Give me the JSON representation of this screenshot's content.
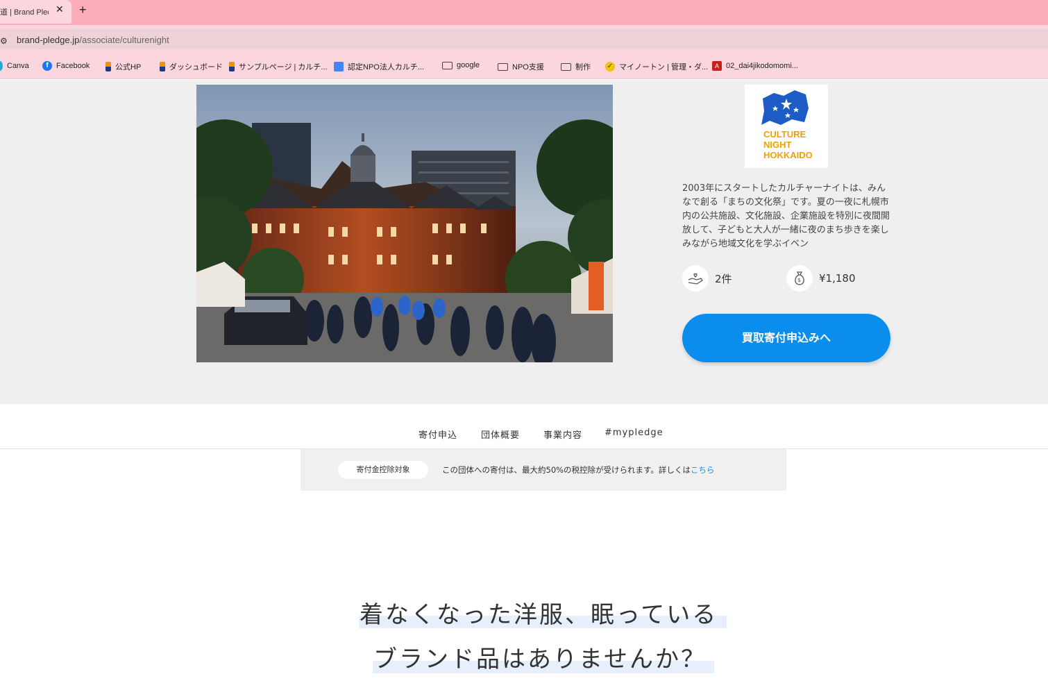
{
  "browser": {
    "tab_title": "道 | Brand Pledge",
    "tab_close": "✕",
    "new_tab": "+",
    "url_host": "brand-pledge.jp",
    "url_path": "/associate/culturenight",
    "bookmarks": [
      {
        "label": "Canva",
        "icon": "canva-icon"
      },
      {
        "label": "Facebook",
        "icon": "facebook-icon"
      },
      {
        "label": "公式HP",
        "icon": "bar-icon"
      },
      {
        "label": "ダッシュボード",
        "icon": "bar-icon"
      },
      {
        "label": "サンプルページ | カルチ...",
        "icon": "bar-icon"
      },
      {
        "label": "認定NPO法人カルチ...",
        "icon": "doc-icon"
      },
      {
        "label": "google",
        "icon": "folder-icon"
      },
      {
        "label": "NPO支援",
        "icon": "folder-icon"
      },
      {
        "label": "制作",
        "icon": "folder-icon"
      },
      {
        "label": "マイノートン | 管理・ダ...",
        "icon": "check-icon"
      },
      {
        "label": "02_dai4jikodomomi...",
        "icon": "pdf-icon"
      }
    ]
  },
  "org": {
    "logo_lines": [
      "CULTURE",
      "NIGHT",
      "HOKKAIDO"
    ],
    "description": "2003年にスタートしたカルチャーナイトは、みんなで創る「まちの文化祭」です。夏の一夜に札幌市内の公共施設、文化施設、企業施設を特別に夜間開放して、子どもと大人が一緒に夜のまち歩きを楽しみながら地域文化を学ぶイベン",
    "donation_count": "2件",
    "donation_amount": "¥1,180",
    "cta_label": "買取寄付申込みへ"
  },
  "nav": {
    "items": [
      "寄付申込",
      "団体概要",
      "事業内容",
      "#mypledge"
    ]
  },
  "tax": {
    "badge": "寄付金控除対象",
    "text": "この団体への寄付は、最大約50%の税控除が受けられます。詳しくは",
    "link": "こちら"
  },
  "headline": {
    "line1": "着なくなった洋服、眠っている",
    "line2": "ブランド品はありませんか？"
  },
  "colors": {
    "tabbar": "#fbaeba",
    "chrome": "#fcd6df",
    "hero_bg": "#efefef",
    "cta": "#0a8ded",
    "logo_orange": "#f0a000",
    "logo_blue": "#1d5cc4"
  }
}
